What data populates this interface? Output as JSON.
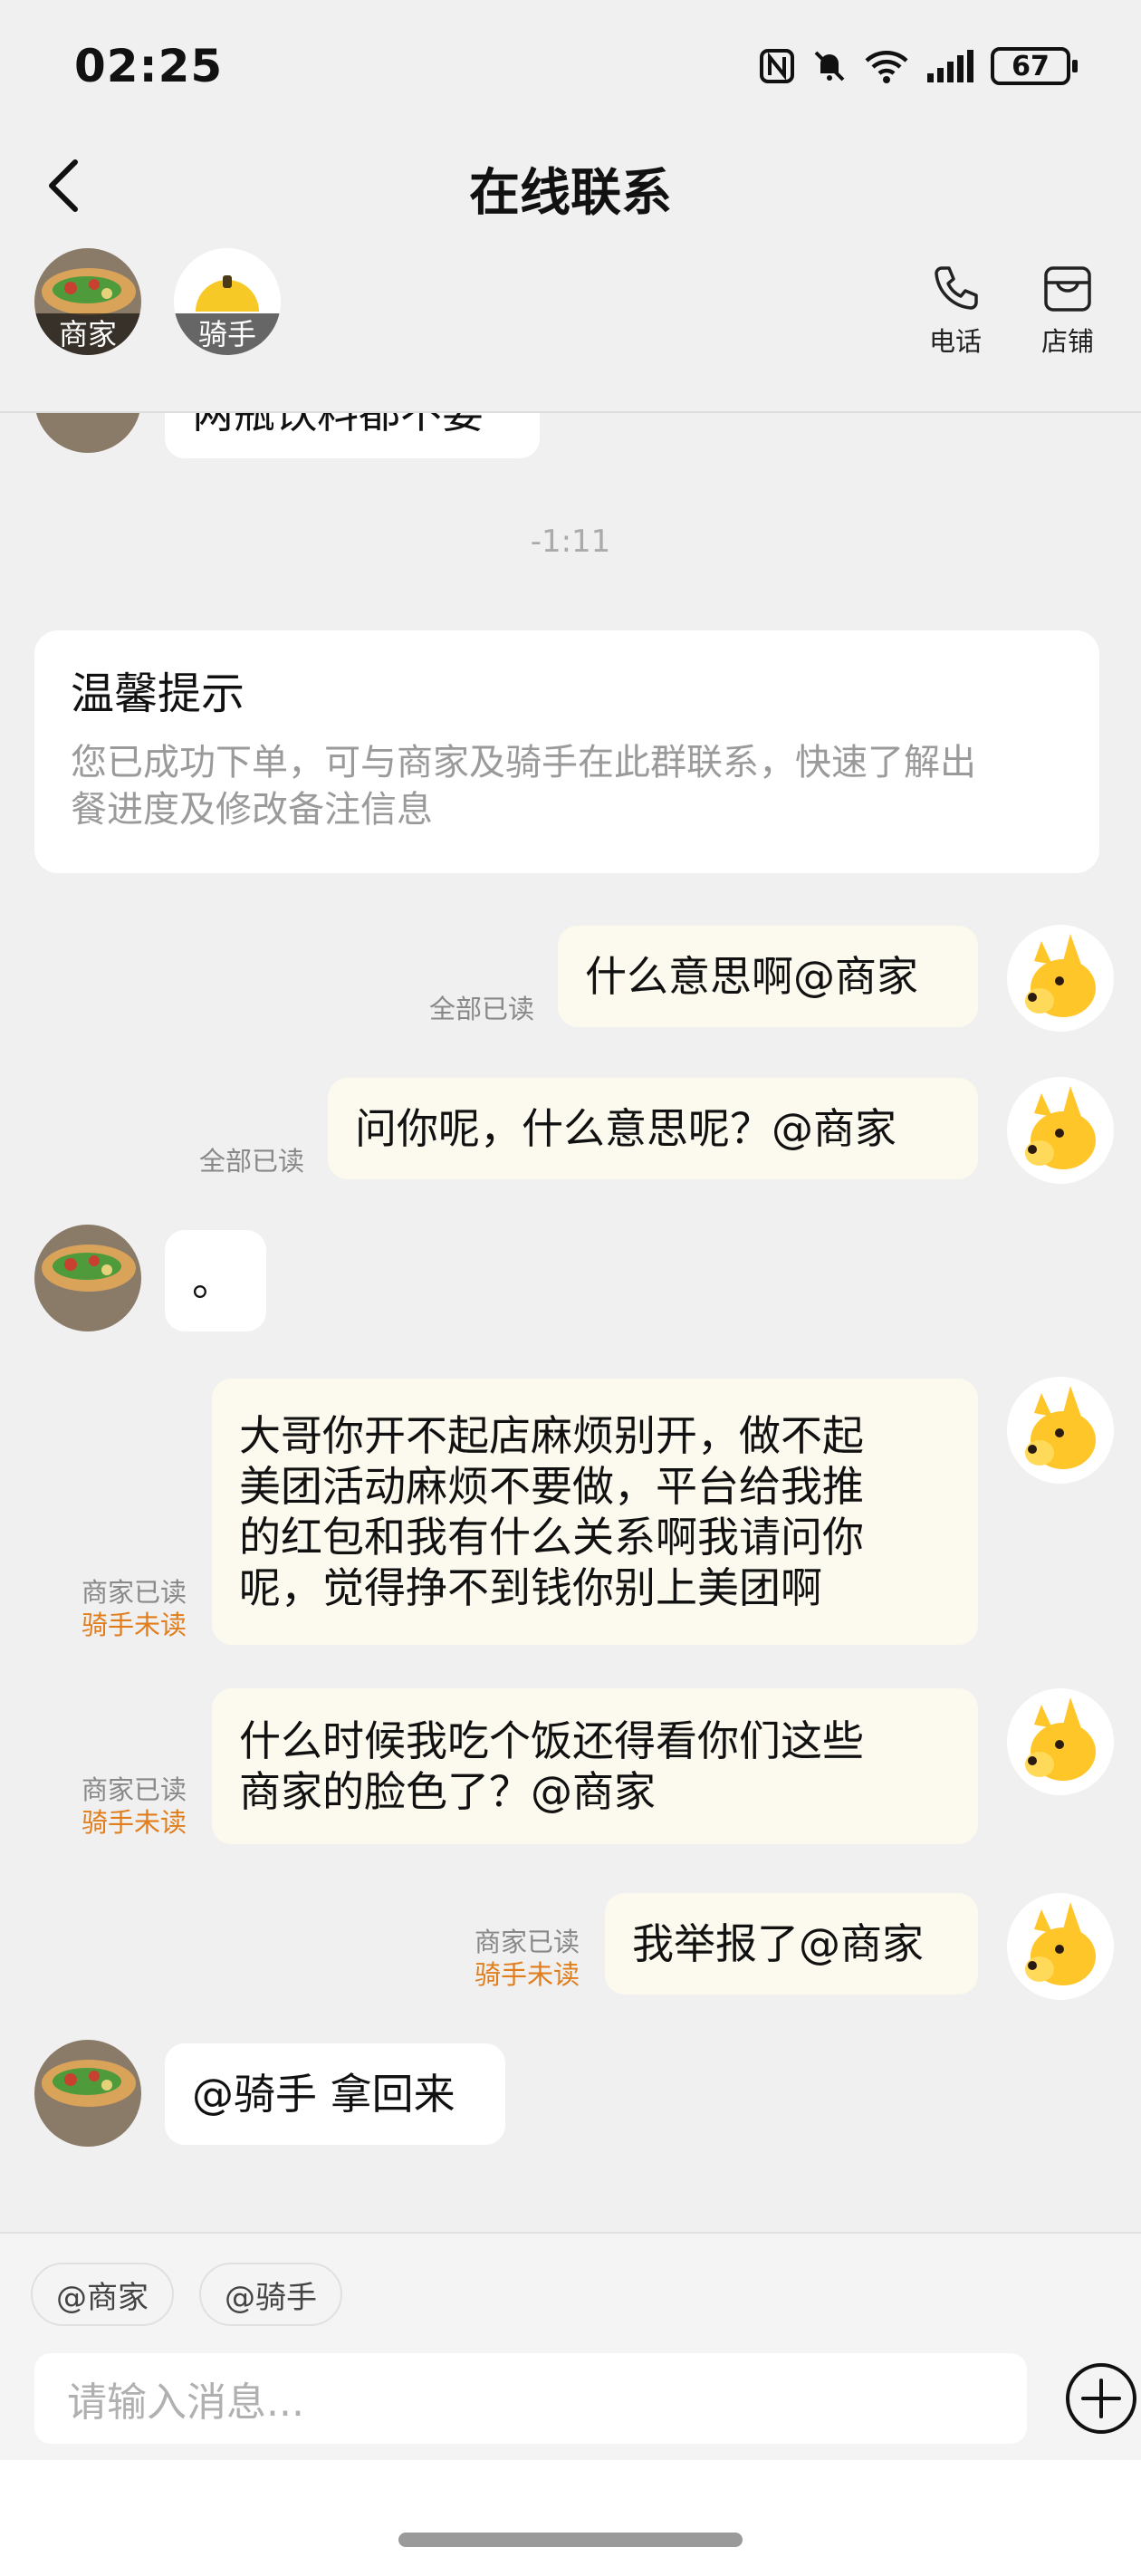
{
  "status_bar": {
    "time": "02:25",
    "battery": "67",
    "icons": [
      "nfc-icon",
      "mute-icon",
      "wifi-icon",
      "signal-icon",
      "battery-icon"
    ]
  },
  "nav": {
    "title": "在线联系",
    "back_icon": "back-arrow-icon"
  },
  "members": {
    "merchant_label": "商家",
    "rider_label": "骑手",
    "phone_label": "电话",
    "store_label": "店铺"
  },
  "chat": {
    "partial_message": "两瓶饮料都不要",
    "time_separator": "-1:11",
    "notice": {
      "title": "温馨提示",
      "body_line1": "您已成功下单，可与商家及骑手在此群联系，快速了解出",
      "body_line2": "餐进度及修改备注信息"
    },
    "messages": [
      {
        "direction": "out",
        "lines": [
          "什么意思啊@商家"
        ],
        "status": [
          "全部已读"
        ]
      },
      {
        "direction": "out",
        "lines": [
          "问你呢，什么意思呢？@商家"
        ],
        "status": [
          "全部已读"
        ]
      },
      {
        "direction": "in",
        "lines": [
          "。"
        ]
      },
      {
        "direction": "out",
        "lines": [
          "大哥你开不起店麻烦别开，做不起",
          "美团活动麻烦不要做，平台给我推",
          "的红包和我有什么关系啊我请问你",
          "呢，觉得挣不到钱你别上美团啊"
        ],
        "status": [
          "商家已读",
          "骑手未读"
        ]
      },
      {
        "direction": "out",
        "lines": [
          "什么时候我吃个饭还得看你们这些",
          "商家的脸色了？@商家"
        ],
        "status": [
          "商家已读",
          "骑手未读"
        ]
      },
      {
        "direction": "out",
        "lines": [
          "我举报了@商家"
        ],
        "status": [
          "商家已读",
          "骑手未读"
        ]
      },
      {
        "direction": "in",
        "lines": [
          "@骑手 拿回来"
        ]
      }
    ]
  },
  "input_area": {
    "chip_merchant": "@商家",
    "chip_rider": "@骑手",
    "placeholder": "请输入消息...",
    "plus_icon": "plus-icon"
  },
  "colors": {
    "background": "#f0f0f0",
    "outgoing_bubble": "#fcf9ee",
    "incoming_bubble": "#ffffff",
    "unread_orange": "#e07d1c",
    "read_grey": "#888888",
    "mascot_yellow": "#ffc62a"
  }
}
